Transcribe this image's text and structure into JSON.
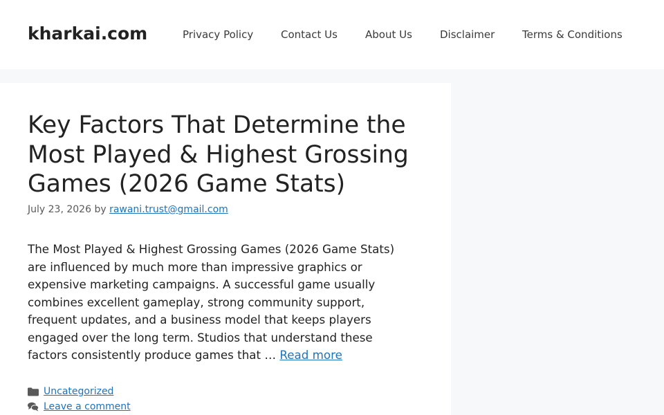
{
  "header": {
    "site_title": "kharkai.com",
    "nav": [
      {
        "label": "Privacy Policy"
      },
      {
        "label": "Contact Us"
      },
      {
        "label": "About Us"
      },
      {
        "label": "Disclaimer"
      },
      {
        "label": "Terms & Conditions"
      }
    ]
  },
  "post": {
    "title": "Key Factors That Determine the Most Played & Highest Grossing Games (2026 Game Stats)",
    "date": "July 23, 2026",
    "by_label": "by",
    "author": "rawani.trust@gmail.com",
    "excerpt": "The Most Played & Highest Grossing Games (2026 Game Stats) are influenced by much more than impressive graphics or expensive marketing campaigns. A successful game usually combines excellent gameplay, strong community support, frequent updates, and a business model that keeps players engaged over the long term. Studios that understand these factors consistently produce games that …",
    "read_more": "Read more",
    "category_icon": "folder-icon",
    "category": "Uncategorized",
    "comment_icon": "comments-icon",
    "comment_link": "Leave a comment"
  },
  "colors": {
    "link": "#1e73be",
    "page_background": "#f7f8f9",
    "content_background": "#ffffff",
    "text": "#222222"
  }
}
